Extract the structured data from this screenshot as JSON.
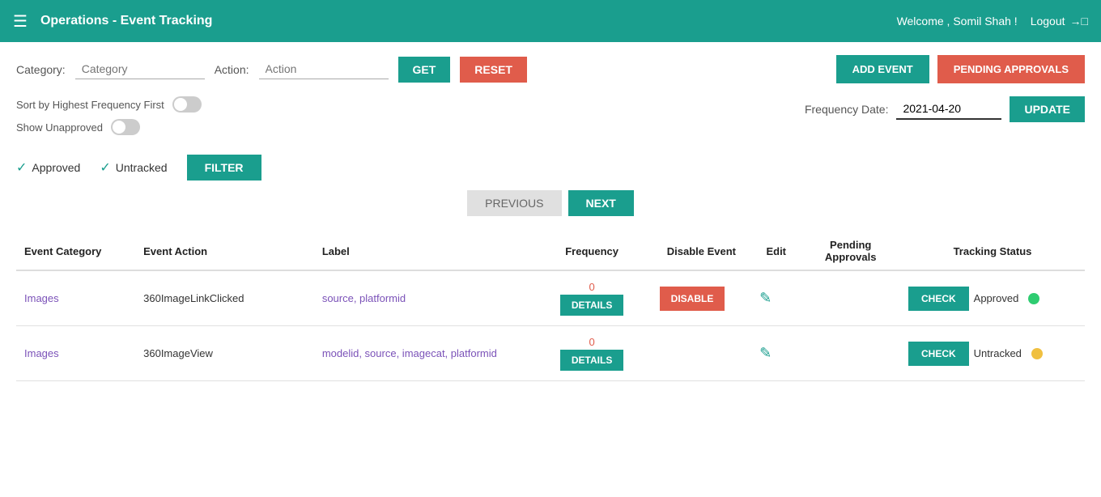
{
  "header": {
    "menu_icon": "≡",
    "title": "Operations - Event Tracking",
    "welcome": "Welcome , Somil Shah !",
    "logout_label": "Logout",
    "logout_icon": "⎋"
  },
  "filters": {
    "category_label": "Category:",
    "category_placeholder": "Category",
    "action_label": "Action:",
    "action_placeholder": "Action",
    "get_label": "GET",
    "reset_label": "RESET",
    "add_event_label": "ADD EVENT",
    "pending_approvals_label": "PENDING APPROVALS"
  },
  "toggles": {
    "sort_label": "Sort by Highest Frequency First",
    "show_unapproved_label": "Show Unapproved"
  },
  "frequency_date": {
    "label": "Frequency Date:",
    "value": "2021-04-20",
    "update_label": "UPDATE"
  },
  "legend": {
    "approved_label": "Approved",
    "untracked_label": "Untracked",
    "filter_label": "FILTER"
  },
  "pagination": {
    "previous_label": "PREVIOUS",
    "next_label": "NEXT"
  },
  "table": {
    "columns": {
      "event_category": "Event Category",
      "event_action": "Event Action",
      "label": "Label",
      "frequency": "Frequency",
      "disable_event": "Disable Event",
      "edit": "Edit",
      "pending_approvals": "Pending Approvals",
      "tracking_status": "Tracking Status"
    },
    "rows": [
      {
        "id": 1,
        "event_category": "Images",
        "event_action": "360ImageLinkClicked",
        "label": "source, platformid",
        "frequency_count": "0",
        "details_label": "DETAILS",
        "disable_label": "DISABLE",
        "check_label": "CHECK",
        "tracking_status": "Approved",
        "status_class": "approved"
      },
      {
        "id": 2,
        "event_category": "Images",
        "event_action": "360ImageView",
        "label": "modelid, source, imagecat, platformid",
        "frequency_count": "0",
        "details_label": "DETAILS",
        "disable_label": "",
        "check_label": "CHECK",
        "tracking_status": "Untracked",
        "status_class": "untracked"
      }
    ]
  }
}
